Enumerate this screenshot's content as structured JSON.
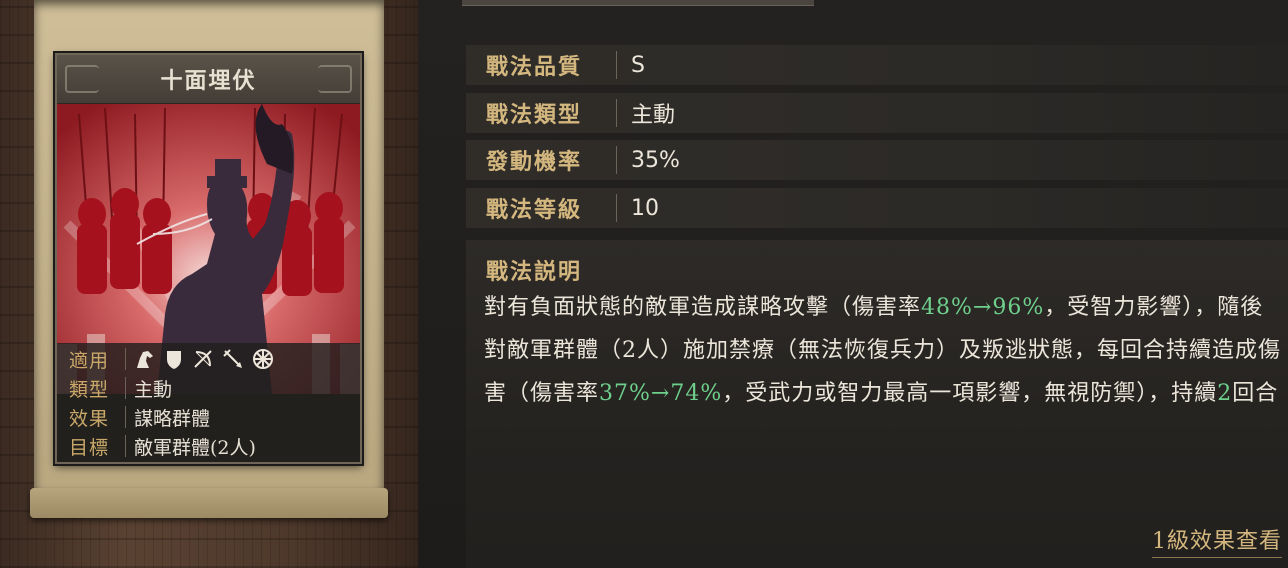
{
  "card": {
    "title": "十面埋伏",
    "info": [
      {
        "key": "適用",
        "value": ""
      },
      {
        "key": "類型",
        "value": "主動"
      },
      {
        "key": "效果",
        "value": "謀略群體"
      },
      {
        "key": "目標",
        "value": "敵軍群體(2人)"
      }
    ],
    "unit_icons": [
      "cavalry-icon",
      "shield-icon",
      "bow-icon",
      "spear-icon",
      "wheel-icon"
    ]
  },
  "stats": [
    {
      "key": "戰法品質",
      "value": "S"
    },
    {
      "key": "戰法類型",
      "value": "主動"
    },
    {
      "key": "發動機率",
      "value": "35%"
    },
    {
      "key": "戰法等級",
      "value": "10"
    }
  ],
  "description": {
    "label": "戰法説明",
    "segments": [
      {
        "text": "對有負面狀態的敵軍造成謀略攻擊（傷害率",
        "hl": false
      },
      {
        "text": "48%→96%",
        "hl": true
      },
      {
        "text": "，受智力影響），隨後對敵軍群體（2人）施加禁療（無法恢復兵力）及叛逃狀態，每回合持續造成傷害（傷害率",
        "hl": false
      },
      {
        "text": "37%→74%",
        "hl": true
      },
      {
        "text": "，受武力或智力最高一項影響，無視防禦），持續",
        "hl": false
      },
      {
        "text": "2",
        "hl": true
      },
      {
        "text": "回合",
        "hl": false
      }
    ]
  },
  "level_link": "1級效果查看",
  "colors": {
    "accent": "#d4b77e",
    "highlight": "#6fcf8c",
    "art_red": "#b8242c"
  }
}
